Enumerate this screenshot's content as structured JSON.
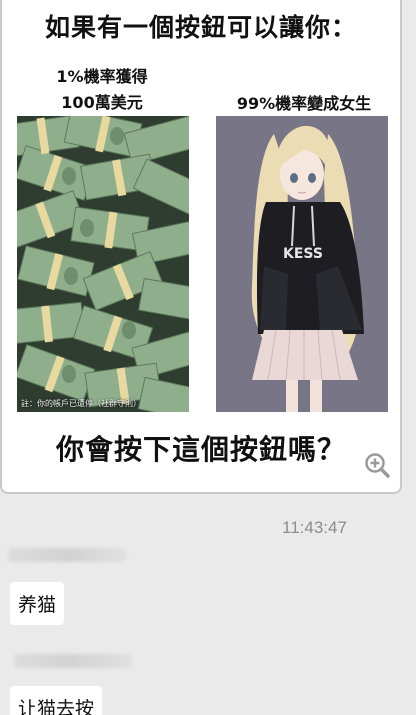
{
  "meme": {
    "title": "如果有一個按鈕可以讓你：",
    "left_caption_line1": "1%機率獲得",
    "left_caption_line2": "100萬美元",
    "right_caption": "99%機率變成女生",
    "hoodie_text": "KESS",
    "watermark": "註：你的帳戶已遭停（社群守則）",
    "question": "你會按下這個按鈕嗎？"
  },
  "chat": {
    "timestamp": "11:43:47",
    "messages": [
      {
        "text": "养猫"
      },
      {
        "text": "让猫去按"
      }
    ]
  },
  "colors": {
    "money_bg": "#2f3d30",
    "bill_green": "#8fae8c",
    "band_yellow": "#e8d9a0",
    "girl_bg": "#787586",
    "hoodie": "#1d1d22",
    "hair": "#ecdcb4",
    "skirt": "#e9d8d6"
  },
  "icons": {
    "zoom": "zoom-in-icon"
  }
}
